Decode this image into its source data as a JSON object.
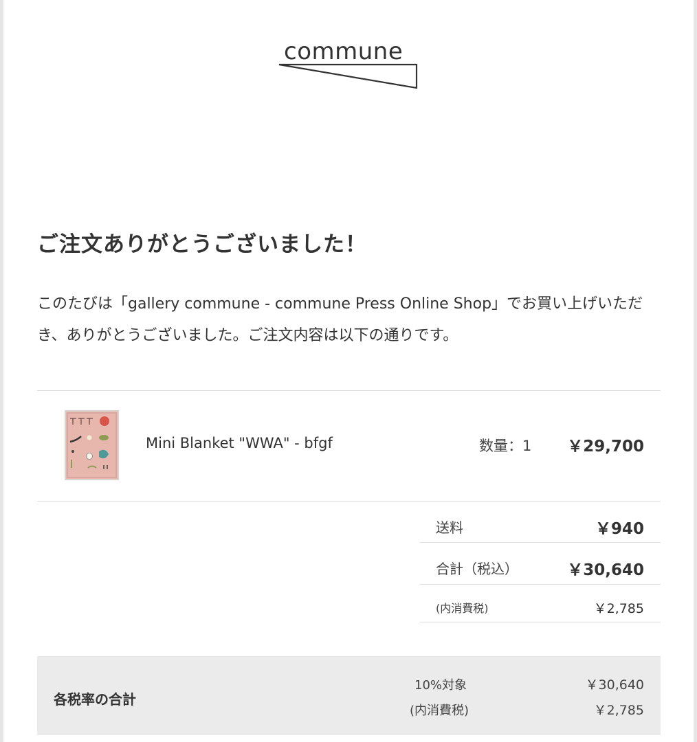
{
  "brand": {
    "logo_text": "commune"
  },
  "heading": "ご注文ありがとうございました！",
  "intro": "このたびは「gallery commune - commune Press Online Shop」でお買い上げいただき、ありがとうございました。ご注文内容は以下の通りです。",
  "item": {
    "name": "Mini Blanket \"WWA\" - bfgf",
    "quantity_label": "数量：",
    "quantity": "1",
    "price": "￥29,700",
    "thumbnail_colors": {
      "background": "#e7b6ad",
      "red": "#d8554a",
      "teal": "#4e9a98",
      "olive": "#8e9b52"
    }
  },
  "summary": {
    "shipping_label": "送料",
    "shipping_value": "￥940",
    "total_label": "合計（税込）",
    "total_value": "￥30,640",
    "tax_label": "(内消費税)",
    "tax_value": "￥2,785"
  },
  "tax_breakdown": {
    "title": "各税率の合計",
    "rate_label": "10%対象",
    "rate_value": "￥30,640",
    "inner_tax_label": "(内消費税)",
    "inner_tax_value": "￥2,785"
  },
  "colors": {
    "text": "#333333",
    "divider": "#dcdcdc",
    "box_bg": "#ebebeb",
    "frame": "#e6e6e6"
  }
}
